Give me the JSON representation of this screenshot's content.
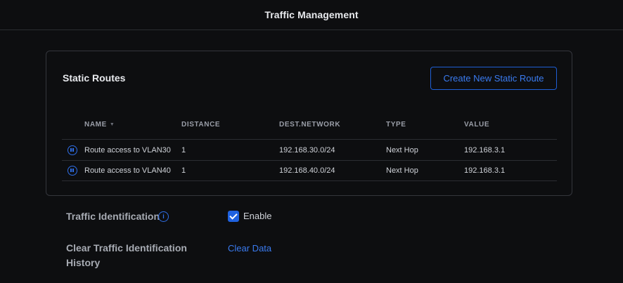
{
  "header": {
    "title": "Traffic Management"
  },
  "static_routes": {
    "title": "Static Routes",
    "create_button": "Create New Static Route",
    "columns": [
      "NAME",
      "DISTANCE",
      "DEST.NETWORK",
      "TYPE",
      "VALUE"
    ],
    "rows": [
      {
        "name": "Route access to VLAN30",
        "distance": "1",
        "dest_network": "192.168.30.0/24",
        "type": "Next Hop",
        "value": "192.168.3.1",
        "status_icon": "pause-icon"
      },
      {
        "name": "Route access to VLAN40",
        "distance": "1",
        "dest_network": "192.168.40.0/24",
        "type": "Next Hop",
        "value": "192.168.3.1",
        "status_icon": "pause-icon"
      }
    ]
  },
  "traffic_identification": {
    "label": "Traffic Identification",
    "info_icon": "i",
    "checkbox_label": "Enable",
    "checked": true
  },
  "clear_history": {
    "label_line1": "Clear Traffic Identification",
    "label_line2": "History",
    "action": "Clear Data"
  },
  "colors": {
    "accent": "#1f62e0",
    "link": "#3a7bf0",
    "background": "#0d0e10",
    "border": "#34363c"
  }
}
